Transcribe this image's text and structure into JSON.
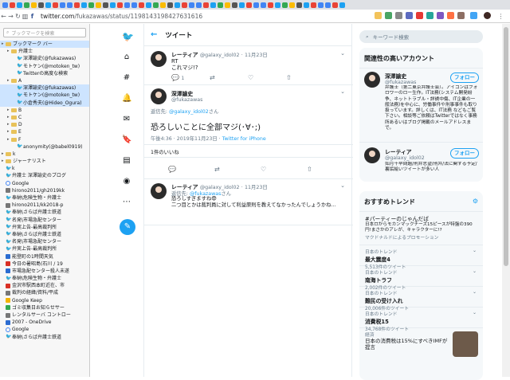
{
  "browser": {
    "url_prefix": "twitter.com",
    "url_rest": "/fukazawas/status/1198143198427631616"
  },
  "sidebar": {
    "search_placeholder": "ブックマークを検索",
    "items": [
      {
        "label": "ブックマーク バー",
        "indent": 1,
        "icon": "folder",
        "selected": true
      },
      {
        "label": "弁護士",
        "indent": 2,
        "icon": "folder"
      },
      {
        "label": "深澤諭史(@fukazawas)",
        "indent": 3,
        "icon": "twitter"
      },
      {
        "label": "モトケン(@motoken_tw)",
        "indent": 3,
        "icon": "twitter"
      },
      {
        "label": "Twitterの高度な検索",
        "indent": 3,
        "icon": "twitter"
      },
      {
        "label": "A",
        "indent": 2,
        "icon": "folder"
      },
      {
        "label": "深澤諭史(@fukazawas)",
        "indent": 3,
        "icon": "twitter",
        "selected": true
      },
      {
        "label": "モトケン(@motoken_tw)",
        "indent": 3,
        "icon": "twitter",
        "selected": true
      },
      {
        "label": "小倉秀夫(@Hideo_Ogura)",
        "indent": 3,
        "icon": "twitter",
        "selected": true
      },
      {
        "label": "B",
        "indent": 2,
        "icon": "folder"
      },
      {
        "label": "C",
        "indent": 2,
        "icon": "folder"
      },
      {
        "label": "D",
        "indent": 2,
        "icon": "folder"
      },
      {
        "label": "E",
        "indent": 2,
        "icon": "folder"
      },
      {
        "label": "F",
        "indent": 2,
        "icon": "folder"
      },
      {
        "label": "anonymity(@babel0919)",
        "indent": 3,
        "icon": "twitter"
      },
      {
        "label": "k",
        "indent": 1,
        "icon": "folder"
      },
      {
        "label": "ジャーナリスト",
        "indent": 1,
        "icon": "folder"
      },
      {
        "label": "k",
        "indent": 1,
        "icon": "twitter"
      },
      {
        "label": "弁護士 深澤諭史のブログ",
        "indent": 1,
        "icon": "twitter"
      },
      {
        "label": "Google",
        "indent": 1,
        "icon": "google"
      },
      {
        "label": "hirono2011/gh2019kk",
        "indent": 1,
        "icon": "square-gray"
      },
      {
        "label": "奉納\\危険生物・弁護士",
        "indent": 1,
        "icon": "twitter"
      },
      {
        "label": "hirono2011/kk2018-p",
        "indent": 1,
        "icon": "square-gray"
      },
      {
        "label": "奉納\\さらば弁護士鉄道",
        "indent": 1,
        "icon": "twitter"
      },
      {
        "label": "名発\\市場急配センター",
        "indent": 1,
        "icon": "twitter"
      },
      {
        "label": "弁実上告-最高裁判所",
        "indent": 1,
        "icon": "twitter"
      },
      {
        "label": "奉納\\さらば弁護士鉄道",
        "indent": 1,
        "icon": "twitter"
      },
      {
        "label": "名発\\市場急配センター",
        "indent": 1,
        "icon": "twitter"
      },
      {
        "label": "弁実上告-最高裁判所",
        "indent": 1,
        "icon": "twitter"
      },
      {
        "label": "能登町の1時間天気",
        "indent": 1,
        "icon": "square-blue"
      },
      {
        "label": "今日の暑昭島(石川 / 19",
        "indent": 1,
        "icon": "square-red"
      },
      {
        "label": "市場急配センター殺人未遂",
        "indent": 1,
        "icon": "square-blue"
      },
      {
        "label": "奉納\\危険生物・弁護士",
        "indent": 1,
        "icon": "twitter"
      },
      {
        "label": "金沢市駅西本町近在、市",
        "indent": 1,
        "icon": "square-red"
      },
      {
        "label": "裁判の経緯/資料/平成",
        "indent": 1,
        "icon": "square-gray"
      },
      {
        "label": "Google Keep",
        "indent": 1,
        "icon": "square-yellow"
      },
      {
        "label": "ゴミ収集日お知らせサー",
        "indent": 1,
        "icon": "square-green"
      },
      {
        "label": "レンタルサーバ コントロー",
        "indent": 1,
        "icon": "square-gray"
      },
      {
        "label": "2007 - OneDrive",
        "indent": 1,
        "icon": "square-blue"
      },
      {
        "label": "Google",
        "indent": 1,
        "icon": "google"
      },
      {
        "label": "奉納\\さらば弁護士鉄道",
        "indent": 1,
        "icon": "twitter"
      }
    ]
  },
  "main": {
    "title": "ツイート",
    "tweet1": {
      "name": "レーティア",
      "handle": "@galaxy_idol02",
      "date": "11月23日",
      "line1": "RT",
      "line2": "これマジ!?",
      "reply_count": "1"
    },
    "tweet2": {
      "name": "深澤諭史",
      "handle": "@fukazawas",
      "reply_to_label": "返信先:",
      "reply_to_handle": "@galaxy_idol02",
      "reply_to_suffix": "さん",
      "text": "恐ろしいことに全部マジ(･∀･;)",
      "time": "午後4:36 · 2019年11月23日 · ",
      "client": "Twitter for iPhone",
      "likes": "1件のいいね"
    },
    "tweet3": {
      "name": "レーティア",
      "handle": "@galaxy_idol02",
      "date": "11月23日",
      "reply_to_label": "返信先:",
      "reply_to_handle": "@fukazawas",
      "reply_to_suffix": "さん",
      "line1": "恐ろしすぎますね😨",
      "line2": "二つ目とかは裁判員に対して利益原則を教えてなかったんでしょうかね…"
    }
  },
  "right": {
    "search_placeholder": "キーワード検索",
    "accounts_title": "関連性の高いアカウント",
    "accounts": [
      {
        "name": "深澤諭史",
        "handle": "@fukazawas",
        "follow": "フォロー",
        "bio": "弁護士（第二東京弁護士会）。アイコンはフォロワーのロー生作。IT法務(システム開発紛争、ネットトラブル・詳誘中傷、IT企業の一般法務)を中心に、労働事件や刑事事件も取り扱っています。詳しくは、IT法務 などもご覧下さい。相談等ご依頼はTwitterではなく事務所あるいはブログ掲載のメールアドレスまで。"
      },
      {
        "name": "レーティア",
        "handle": "@galaxy_idol02",
        "follow": "フォロー",
        "bio": "如月千早問題/刑弁志望/刑弁/法に関する予定/裏垢絵いツイートが多い人"
      }
    ],
    "trends_title": "おすすめトレンド",
    "trends": [
      {
        "cat": "",
        "name": "#パーティーのじゃんだば",
        "desc": "日本ロからモカンマックチーズ15ピースが特盤の390円!まさかのアレが、キャラクターに!?",
        "promo": "マクドナルドによるプロモーション"
      },
      {
        "cat": "日本のトレンド",
        "name": "最大震度4",
        "count": "5,513件のツイート"
      },
      {
        "cat": "日本のトレンド",
        "name": "南海トラフ",
        "count": "2,002件のツイート"
      },
      {
        "cat": "日本のトレンド",
        "name": "難民の受け入れ",
        "count": "20,006件のツイート"
      },
      {
        "cat": "日本のトレンド",
        "name": "消費税15",
        "count": "34,768件のツイート"
      },
      {
        "cat": "経済",
        "name": "日本の消費税は15%にすべきIMFが提言",
        "count": ""
      }
    ]
  },
  "colors": {
    "accent": "#1da1f2"
  }
}
